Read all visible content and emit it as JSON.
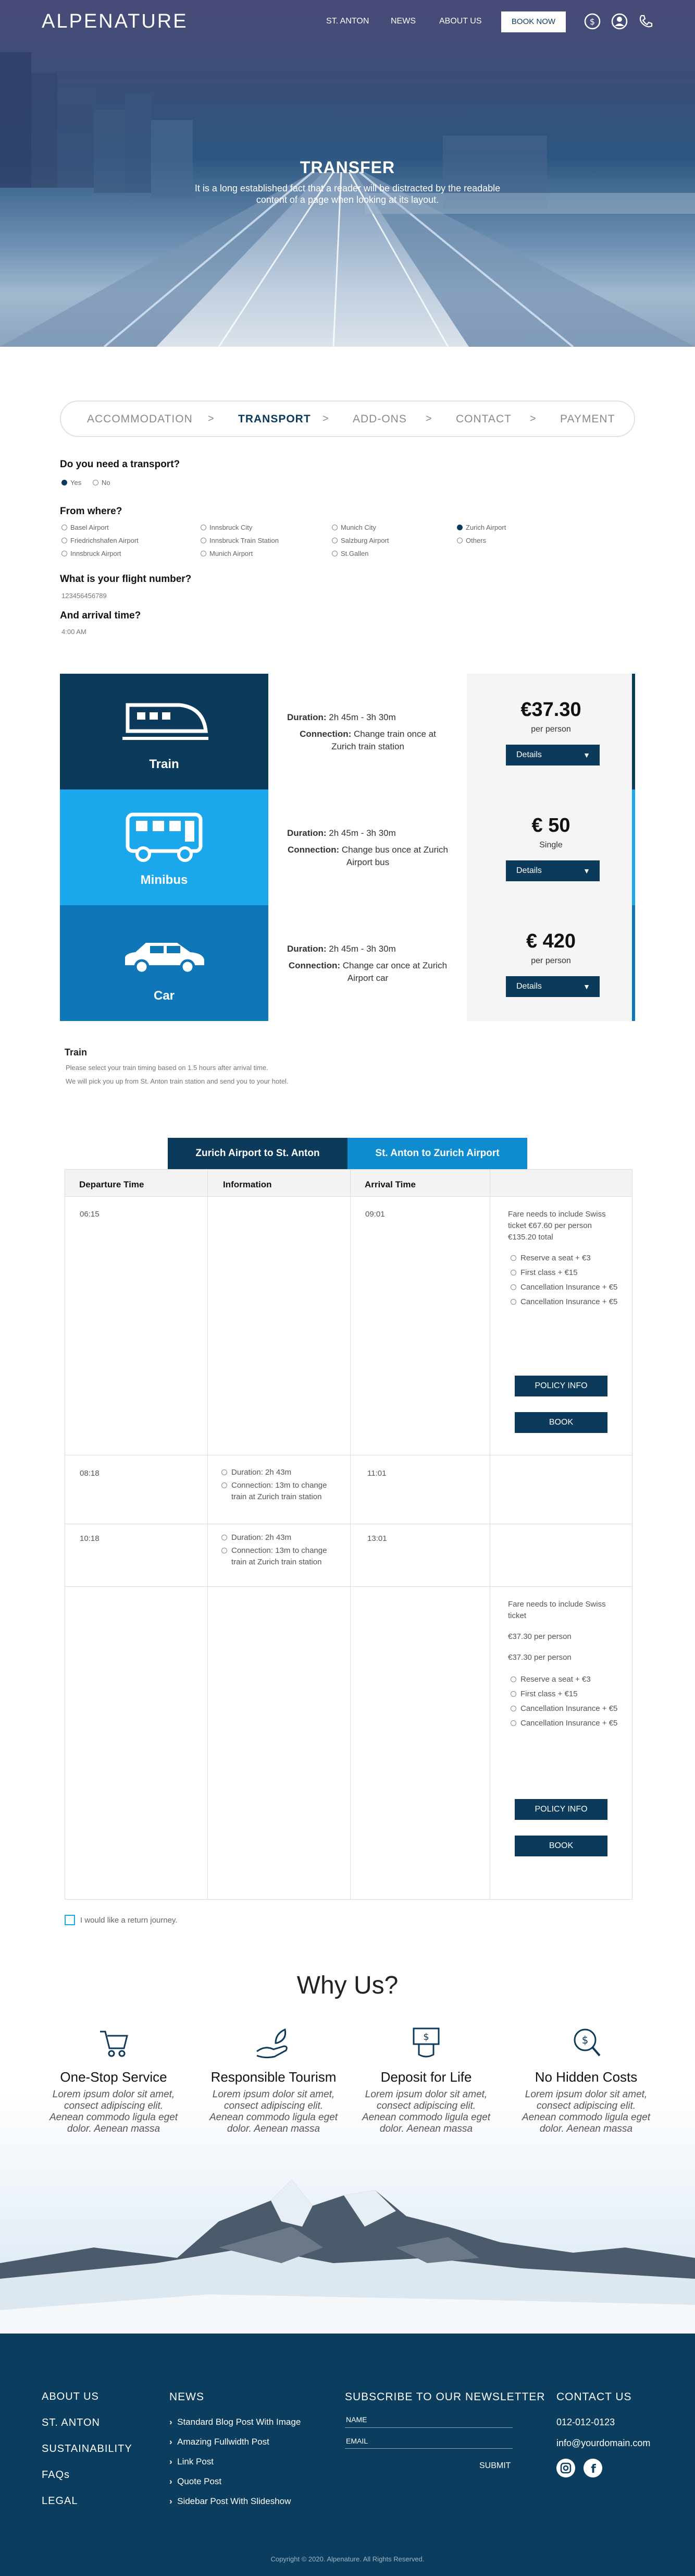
{
  "nav": {
    "logo": "ALPENATURE",
    "links": [
      "ST. ANTON",
      "NEWS",
      "ABOUT US"
    ],
    "book": "BOOK NOW"
  },
  "hero": {
    "title": "TRANSFER",
    "subtitle": "It is a long established fact that a reader will be distracted by the readable content of a page when looking at its layout."
  },
  "steps": [
    "ACCOMMODATION",
    "TRANSPORT",
    "ADD-ONS",
    "CONTACT",
    "PAYMENT"
  ],
  "steps_sep": ">",
  "form": {
    "q_transport": "Do you need a transport?",
    "yes": "Yes",
    "no": "No",
    "q_from": "From where?",
    "from_options": [
      "Basel Airport",
      "Innsbruck City",
      "Munich City",
      "Zurich Airport",
      "Friedrichshafen Airport",
      "Innsbruck Train Station",
      "Salzburg Airport",
      "Others",
      "Innsbruck Airport",
      "Munich Airport",
      "St.Gallen"
    ],
    "q_flight": "What is your flight number?",
    "flight": "123456456789",
    "q_arrival": "And arrival time?",
    "arrival": "4:00 AM"
  },
  "cards": [
    {
      "name": "Train",
      "duration_label": "Duration:",
      "duration": "2h 45m - 3h 30m",
      "conn_label": "Connection:",
      "conn": "Change train once at Zurich train station",
      "price": "€37.30",
      "unit": "per person",
      "btn": "Details",
      "color": "#0c3a5b"
    },
    {
      "name": "Minibus",
      "duration_label": "Duration:",
      "duration": "2h 45m - 3h 30m",
      "conn_label": "Connection:",
      "conn": "Change bus once at Zurich Airport  bus",
      "price": "€ 50",
      "unit": "Single",
      "btn": "Details",
      "color": "#1aa7ec"
    },
    {
      "name": "Car",
      "duration_label": "Duration:",
      "duration": "2h 45m - 3h 30m",
      "conn_label": "Connection:",
      "conn": "Change car once at Zurich Airport car",
      "price": "€ 420",
      "unit": "per person",
      "btn": "Details",
      "color": "#0f76b8"
    }
  ],
  "train_info": {
    "title": "Train",
    "line1": "Please select your train timing based on 1.5 hours after arrival time.",
    "line2": "We will pick you up from St. Anton train station and send you to your hotel."
  },
  "tabs": [
    "Zurich Airport to St. Anton",
    "St. Anton to Zurich Airport"
  ],
  "table": {
    "headers": [
      "Departure Time",
      "Information",
      "Arrival Time"
    ],
    "rows": [
      {
        "dep": "06:15",
        "arr": "09:01"
      },
      {
        "dep": "08:18",
        "arr": "11:01",
        "info": [
          "Duration: 2h 43m",
          "Connection: 13m to change train at Zurich train station"
        ]
      },
      {
        "dep": "10:18",
        "arr": "13:01",
        "info": [
          "Duration: 2h 43m",
          "Connection: 13m to change train at Zurich train station"
        ]
      }
    ],
    "fare1": {
      "text": "Fare needs to include Swiss ticket €67.60 per person",
      "total": "€135.20 total",
      "extras": [
        "Reserve a seat + €3",
        "First class + €15",
        "Cancellation Insurance + €5",
        "Cancellation Insurance + €5"
      ]
    },
    "fare2": {
      "text": "Fare needs to include Swiss ticket",
      "p1": "€37.30 per person",
      "p2": "€37.30 per person",
      "extras": [
        "Reserve a seat + €3",
        "First class + €15",
        "Cancellation Insurance + €5",
        "Cancellation Insurance + €5"
      ]
    },
    "policy": "POLICY INFO",
    "book": "BOOK",
    "return": "I would like a return journey."
  },
  "why": {
    "title": "Why Us?",
    "features": [
      {
        "title": "One-Stop Service",
        "icon": "cart-icon",
        "desc": "Lorem ipsum dolor sit amet, consect adipiscing elit. Aenean commodo ligula eget dolor. Aenean massa"
      },
      {
        "title": "Responsible Tourism",
        "icon": "plant-hand-icon",
        "desc": "Lorem ipsum dolor sit amet, consect adipiscing elit. Aenean commodo ligula eget dolor. Aenean massa"
      },
      {
        "title": "Deposit for Life",
        "icon": "money-icon",
        "desc": "Lorem ipsum dolor sit amet, consect adipiscing elit. Aenean commodo ligula eget dolor. Aenean massa"
      },
      {
        "title": "No Hidden Costs",
        "icon": "search-money-icon",
        "desc": "Lorem ipsum dolor sit amet, consect adipiscing elit. Aenean commodo ligula eget dolor. Aenean massa"
      }
    ]
  },
  "footer": {
    "col1": [
      "ABOUT US",
      "ST. ANTON",
      "SUSTAINABILITY",
      "FAQs",
      "LEGAL"
    ],
    "news_title": "NEWS",
    "news": [
      "Standard Blog Post With Image",
      "Amazing Fullwidth Post",
      "Link Post",
      "Quote Post",
      "Sidebar Post With Slideshow"
    ],
    "newsletter_title": "SUBSCRIBE TO OUR NEWSLETTER",
    "name": "NAME",
    "email": "EMAIL",
    "submit": "SUBMIT",
    "contact_title": "CONTACT US",
    "phone": "012-012-0123",
    "mail": "info@yourdomain.com",
    "copyright": "Copyright © 2020. Alpenature. All Rights Reserved."
  },
  "colors": {
    "navy": "#0c3a5b",
    "accent": "#1aa7ec",
    "footer": "#0b3e5e"
  }
}
